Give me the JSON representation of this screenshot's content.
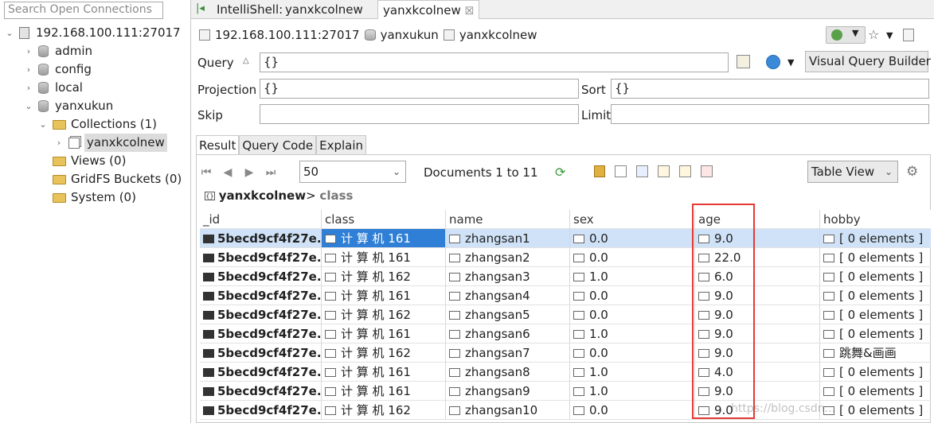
{
  "sidebar": {
    "search_placeholder": "Search Open Connections",
    "tree": [
      {
        "label": "192.168.100.111:27017",
        "type": "server",
        "expanded": true
      },
      {
        "label": "admin",
        "type": "db",
        "expanded": false
      },
      {
        "label": "config",
        "type": "db",
        "expanded": false
      },
      {
        "label": "local",
        "type": "db",
        "expanded": false
      },
      {
        "label": "yanxukun",
        "type": "db",
        "expanded": true
      },
      {
        "label": "Collections (1)",
        "type": "folder",
        "expanded": true
      },
      {
        "label": "yanxkcolnew",
        "type": "collection",
        "selected": true
      },
      {
        "label": "Views (0)",
        "type": "folder"
      },
      {
        "label": "GridFS Buckets (0)",
        "type": "folder"
      },
      {
        "label": "System (0)",
        "type": "folder"
      }
    ]
  },
  "tabs": [
    {
      "label": "IntelliShell:",
      "active": false
    },
    {
      "label": "yanxkcolnew",
      "active": false
    },
    {
      "label": "yanxkcolnew",
      "active": true,
      "closable": true
    }
  ],
  "path": {
    "server": "192.168.100.111:27017",
    "db": "yanxukun",
    "collection": "yanxkcolnew"
  },
  "query": {
    "query_label": "Query",
    "query_value": "{}",
    "projection_label": "Projection",
    "projection_value": "{}",
    "sort_label": "Sort",
    "sort_value": "{}",
    "skip_label": "Skip",
    "skip_value": "",
    "limit_label": "Limit",
    "limit_value": "",
    "vqb_label": "Visual Query Builder"
  },
  "result_tabs": [
    "Result",
    "Query Code",
    "Explain"
  ],
  "toolbar": {
    "page_size": "50",
    "documents": "Documents 1 to 11",
    "view": "Table View"
  },
  "breadcrumb": {
    "collection": "yanxkcolnew",
    "sep": ">",
    "field": "class"
  },
  "table": {
    "columns": [
      "_id",
      "class",
      "name",
      "sex",
      "age",
      "hobby"
    ],
    "rows": [
      {
        "id": "5becd9cf4f27e...",
        "class": "计 算 机 161",
        "name": "zhangsan1",
        "sex": "0.0",
        "age": "9.0",
        "hobby": "[ 0 elements ]"
      },
      {
        "id": "5becd9cf4f27e...",
        "class": "计 算 机 161",
        "name": "zhangsan2",
        "sex": "0.0",
        "age": "22.0",
        "hobby": "[ 0 elements ]"
      },
      {
        "id": "5becd9cf4f27e...",
        "class": "计 算 机 162",
        "name": "zhangsan3",
        "sex": "1.0",
        "age": "6.0",
        "hobby": "[ 0 elements ]"
      },
      {
        "id": "5becd9cf4f27e...",
        "class": "计 算 机 161",
        "name": "zhangsan4",
        "sex": "0.0",
        "age": "9.0",
        "hobby": "[ 0 elements ]"
      },
      {
        "id": "5becd9cf4f27e...",
        "class": "计 算 机 162",
        "name": "zhangsan5",
        "sex": "0.0",
        "age": "9.0",
        "hobby": "[ 0 elements ]"
      },
      {
        "id": "5becd9cf4f27e...",
        "class": "计 算 机 161",
        "name": "zhangsan6",
        "sex": "1.0",
        "age": "9.0",
        "hobby": "[ 0 elements ]"
      },
      {
        "id": "5becd9cf4f27e...",
        "class": "计 算 机 162",
        "name": "zhangsan7",
        "sex": "0.0",
        "age": "9.0",
        "hobby": "跳舞&画画"
      },
      {
        "id": "5becd9cf4f27e...",
        "class": "计 算 机 161",
        "name": "zhangsan8",
        "sex": "1.0",
        "age": "4.0",
        "hobby": "[ 0 elements ]"
      },
      {
        "id": "5becd9cf4f27e...",
        "class": "计 算 机 161",
        "name": "zhangsan9",
        "sex": "1.0",
        "age": "9.0",
        "hobby": "[ 0 elements ]"
      },
      {
        "id": "5becd9cf4f27e...",
        "class": "计 算 机 162",
        "name": "zhangsan10",
        "sex": "0.0",
        "age": "9.0",
        "hobby": "[ 0 elements ]"
      }
    ]
  },
  "highlight_color": "#e53935",
  "selection_color": "#cfe2f7",
  "watermark": "https://blog.csdn..."
}
